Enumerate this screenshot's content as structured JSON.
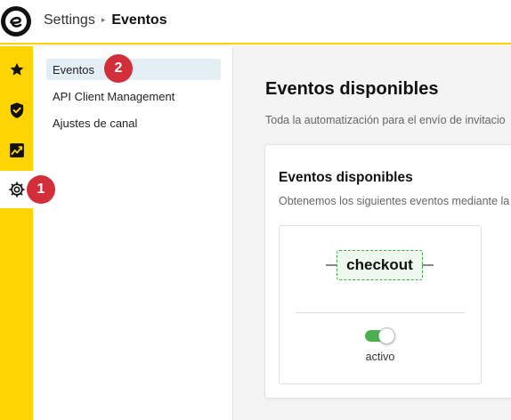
{
  "app": {
    "logo_letter": "e"
  },
  "breadcrumb": {
    "root": "Settings",
    "separator": "▸",
    "current": "Eventos"
  },
  "rail": {
    "items": [
      {
        "icon": "star-icon"
      },
      {
        "icon": "shield-check-icon"
      },
      {
        "icon": "chart-icon"
      },
      {
        "icon": "gear-icon",
        "active": true
      }
    ]
  },
  "subnav": {
    "items": [
      {
        "label": "Eventos",
        "selected": true
      },
      {
        "label": "API Client Management"
      },
      {
        "label": "Ajustes de canal"
      }
    ]
  },
  "badges": {
    "settings": "1",
    "eventos": "2"
  },
  "main": {
    "title": "Eventos disponibles",
    "subtitle": "Toda la automatización para el envío de invitacio",
    "card": {
      "title": "Eventos disponibles",
      "subtitle": "Obtenemos los siguientes eventos mediante la",
      "event": {
        "name": "checkout",
        "toggle_state": "on",
        "toggle_label": "activo"
      }
    }
  },
  "colors": {
    "rail_yellow": "#ffd400",
    "badge_red": "#d22f3a",
    "toggle_green": "#4caf50",
    "selected_bg": "#e4eef5"
  }
}
